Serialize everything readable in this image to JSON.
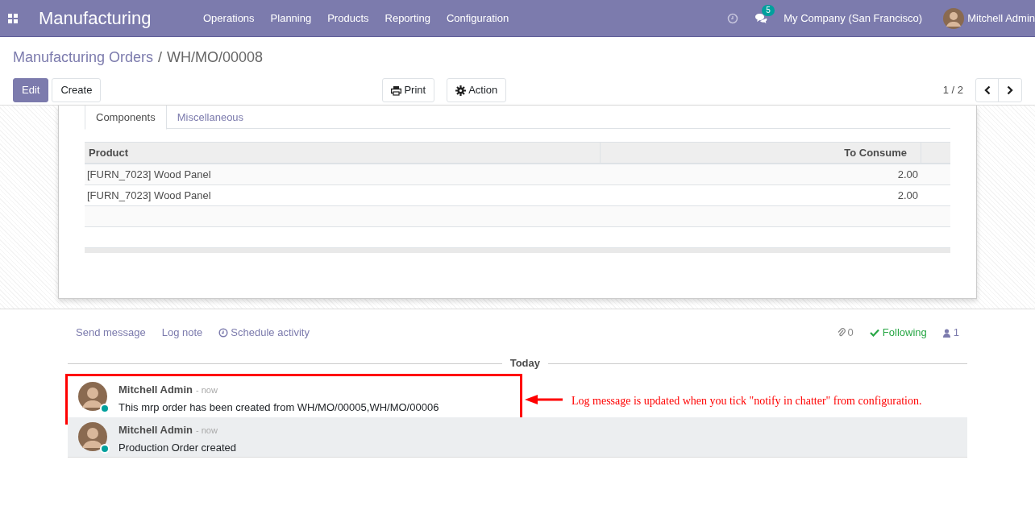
{
  "navbar": {
    "app_name": "Manufacturing",
    "menu": [
      "Operations",
      "Planning",
      "Products",
      "Reporting",
      "Configuration"
    ],
    "message_count": "5",
    "company": "My Company (San Francisco)",
    "user": "Mitchell Admin"
  },
  "breadcrumb": {
    "parent": "Manufacturing Orders",
    "separator": "/",
    "current": "WH/MO/00008"
  },
  "buttons": [
    {
      "label": "Edit",
      "kind": "primary"
    },
    {
      "label": "Create",
      "kind": "secondary"
    }
  ],
  "actions": [
    {
      "label": "Print",
      "kind": "print"
    },
    {
      "label": "Action",
      "kind": "gear"
    }
  ],
  "pager": "1 / 2",
  "tabs": [
    {
      "label": "Components",
      "selected": true
    },
    {
      "label": "Miscellaneous",
      "selected": false
    }
  ],
  "table": {
    "columns": [
      "Product",
      "To Consume"
    ],
    "rows": [
      {
        "product": "[FURN_7023] Wood Panel",
        "to_consume": "2.00"
      },
      {
        "product": "[FURN_7023] Wood Panel",
        "to_consume": "2.00"
      }
    ]
  },
  "chatter": {
    "actions": [
      "Send message",
      "Log note",
      "Schedule activity"
    ],
    "attachments": "0",
    "following": "Following",
    "followers": "1",
    "date_separator": "Today",
    "messages": [
      {
        "author": "Mitchell Admin",
        "time": "- now",
        "body": "This mrp order has been created from WH/MO/00005,WH/MO/00006",
        "highlighted": true
      },
      {
        "author": "Mitchell Admin",
        "time": "- now",
        "body": "Production Order created",
        "highlighted": false
      }
    ]
  },
  "annotation": "Log message is updated when you tick \"notify in chatter\" from configuration."
}
